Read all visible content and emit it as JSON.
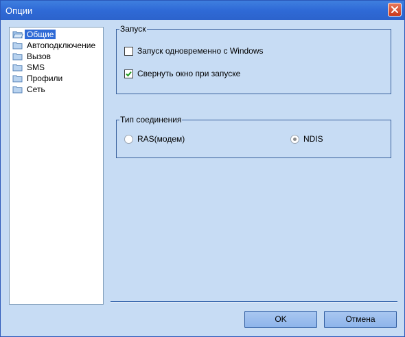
{
  "window": {
    "title": "Опции"
  },
  "tree": {
    "items": [
      {
        "label": "Общие",
        "selected": true
      },
      {
        "label": "Автоподключение",
        "selected": false
      },
      {
        "label": "Вызов",
        "selected": false
      },
      {
        "label": "SMS",
        "selected": false
      },
      {
        "label": "Профили",
        "selected": false
      },
      {
        "label": "Сеть",
        "selected": false
      }
    ]
  },
  "startup": {
    "title": "Запуск",
    "options": [
      {
        "label": "Запуск одновременно с Windows",
        "checked": false
      },
      {
        "label": "Свернуть окно при запуске",
        "checked": true
      }
    ]
  },
  "connection": {
    "title": "Тип соединения",
    "options": [
      {
        "label": "RAS(модем)",
        "selected": false
      },
      {
        "label": "NDIS",
        "selected": true
      }
    ]
  },
  "buttons": {
    "ok": "OK",
    "cancel": "Отмена"
  }
}
